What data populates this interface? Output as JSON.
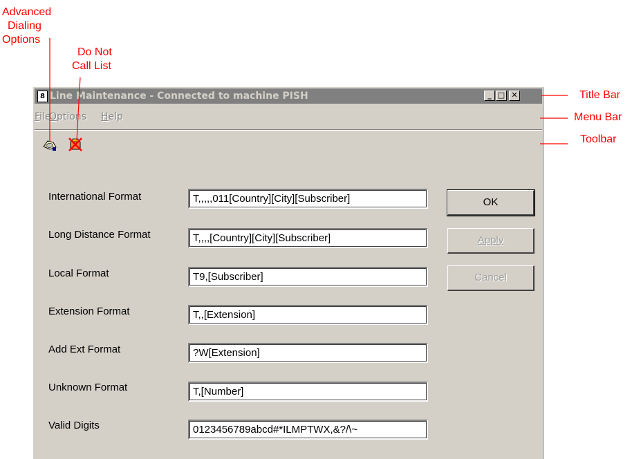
{
  "callouts": {
    "advanced_dialing": [
      "Advanced",
      "Dialing",
      "Options"
    ],
    "do_not_call": [
      "Do Not",
      "Call List"
    ],
    "title_bar": "Title Bar",
    "menu_bar": "Menu Bar",
    "toolbar": "Toolbar"
  },
  "window": {
    "title": "Line Maintenance - Connected to machine PISH",
    "controls": {
      "minimize": "_",
      "maximize": "□",
      "close": "✕"
    }
  },
  "menu": {
    "items": [
      {
        "first": "F",
        "rest": "ile"
      },
      {
        "first": "O",
        "rest": "ptions"
      },
      {
        "first": "H",
        "rest": "elp"
      }
    ]
  },
  "toolbar": {
    "icons": [
      "advanced-dialing-icon",
      "do-not-call-icon"
    ]
  },
  "form": {
    "fields": [
      {
        "label": "International Format",
        "value": "T,,,,,011[Country][City][Subscriber]"
      },
      {
        "label": "Long Distance Format",
        "value": "T,,,,[Country][City][Subscriber]"
      },
      {
        "label": "Local Format",
        "value": "T9,[Subscriber]"
      },
      {
        "label": "Extension Format",
        "value": "T,,[Extension]"
      },
      {
        "label": "Add Ext Format",
        "value": "?W[Extension]"
      },
      {
        "label": "Unknown Format",
        "value": "T,[Number]"
      },
      {
        "label": "Valid Digits",
        "value": "0123456789abcd#*ILMPTWX,&?/\\~"
      }
    ]
  },
  "buttons": {
    "ok": "OK",
    "apply": "Apply",
    "cancel": "Cancel"
  },
  "colors": {
    "annotation": "#ff0000",
    "titlebar_inactive": "#808080",
    "face": "#d4d0c8"
  }
}
